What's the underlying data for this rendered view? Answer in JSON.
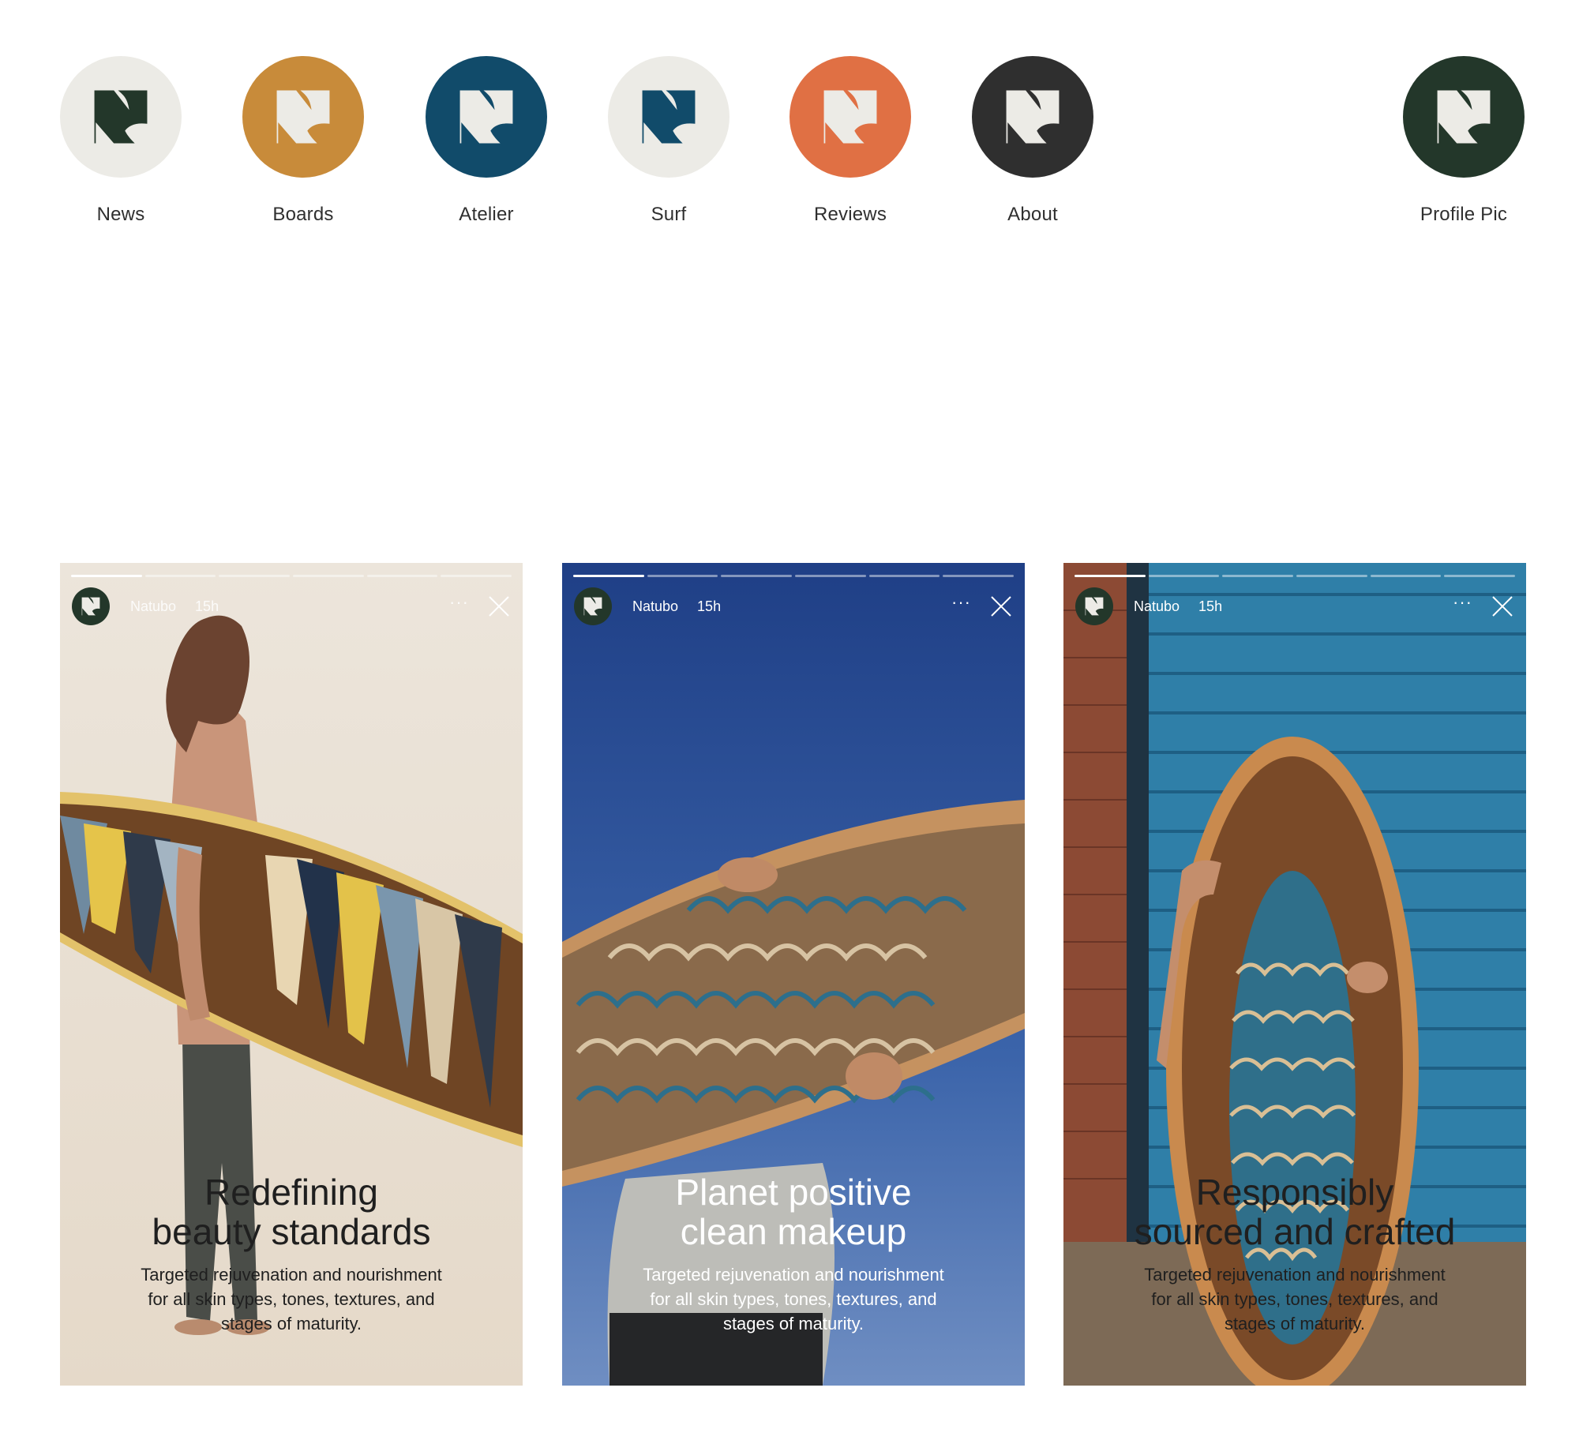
{
  "highlights": [
    {
      "label": "News",
      "bg": "#ecebe6",
      "fg": "#23372a"
    },
    {
      "label": "Boards",
      "bg": "#c88b3a",
      "fg": "#ecebe6"
    },
    {
      "label": "Atelier",
      "bg": "#114b6a",
      "fg": "#ecebe6"
    },
    {
      "label": "Surf",
      "bg": "#ecebe6",
      "fg": "#114b6a"
    },
    {
      "label": "Reviews",
      "bg": "#e07044",
      "fg": "#ecebe6"
    },
    {
      "label": "About",
      "bg": "#2f2f2f",
      "fg": "#ecebe6"
    },
    {
      "label": "Profile Pic",
      "bg": "#23372a",
      "fg": "#ecebe6"
    }
  ],
  "stories": [
    {
      "account": "Natubo",
      "time": "15h",
      "more": "···",
      "headline_line1": "Redefining",
      "headline_line2": "beauty standards",
      "body_line1": "Targeted rejuvenation and nourishment",
      "body_line2": "for all skin types, tones, textures, and",
      "body_line3": "stages of maturity."
    },
    {
      "account": "Natubo",
      "time": "15h",
      "more": "···",
      "headline_line1": "Planet positive",
      "headline_line2": "clean makeup",
      "body_line1": "Targeted rejuvenation and nourishment",
      "body_line2": "for all skin types, tones, textures, and",
      "body_line3": "stages of maturity."
    },
    {
      "account": "Natubo",
      "time": "15h",
      "more": "···",
      "headline_line1": "Responsibly",
      "headline_line2": "sourced and crafted",
      "body_line1": "Targeted rejuvenation and nourishment",
      "body_line2": "for all skin types, tones, textures, and",
      "body_line3": "stages of maturity."
    }
  ],
  "colors": {
    "logo_dark_green": "#23372a",
    "cream": "#ecebe6",
    "ochre": "#c88b3a",
    "petrol": "#114b6a",
    "orange": "#e07044",
    "charcoal": "#2f2f2f"
  }
}
